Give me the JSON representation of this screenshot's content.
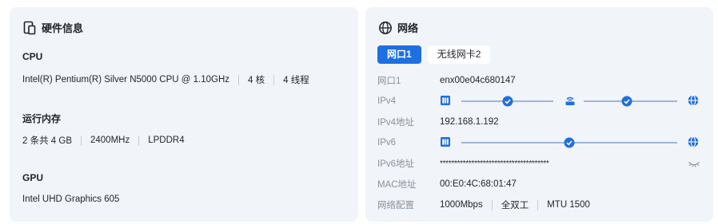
{
  "hardware": {
    "title": "硬件信息",
    "cpu": {
      "heading": "CPU",
      "model": "Intel(R) Pentium(R) Silver N5000 CPU @ 1.10GHz",
      "cores": "4 核",
      "threads": "4 线程"
    },
    "memory": {
      "heading": "运行内存",
      "capacity": "2 条共 4 GB",
      "speed": "2400MHz",
      "type": "LPDDR4"
    },
    "gpu": {
      "heading": "GPU",
      "model": "Intel UHD Graphics 605"
    }
  },
  "network": {
    "title": "网络",
    "tabs": [
      {
        "label": "网口1",
        "active": true
      },
      {
        "label": "无线网卡2",
        "active": false
      }
    ],
    "rows": {
      "port": {
        "label": "网口1",
        "value": "enx00e04c680147"
      },
      "ipv4": {
        "label": "IPv4"
      },
      "ipv4_addr": {
        "label": "IPv4地址",
        "value": "192.168.1.192"
      },
      "ipv6": {
        "label": "IPv6"
      },
      "ipv6_addr": {
        "label": "IPv6地址",
        "value": "**************************************"
      },
      "mac": {
        "label": "MAC地址",
        "value": "00:E0:4C:68:01:47"
      },
      "config": {
        "label": "网络配置",
        "speed": "1000Mbps",
        "duplex": "全双工",
        "mtu": "MTU 1500"
      }
    }
  },
  "colors": {
    "accent": "#1e6fe0",
    "card_bg": "#f1f4f9",
    "label_gray": "#8a929c"
  }
}
